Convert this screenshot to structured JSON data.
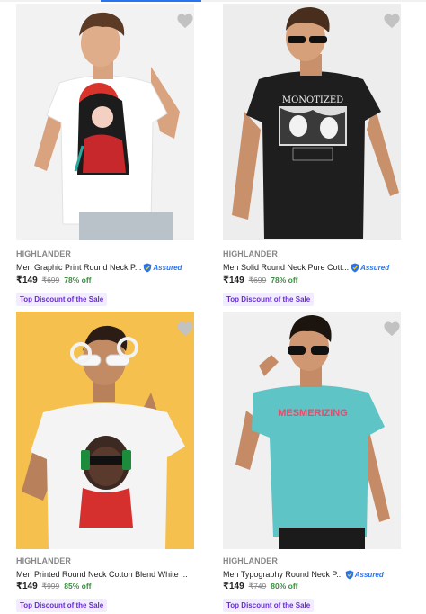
{
  "products": [
    {
      "brand": "HIGHLANDER",
      "title": "Men Graphic Print Round Neck P...",
      "assured": true,
      "assured_label": "Assured",
      "price": "₹149",
      "mrp": "₹699",
      "discount": "78% off",
      "badge": "Top Discount of the Sale",
      "tee_color": "#ffffff",
      "bg_color": "#f3f3f3",
      "print_text": ""
    },
    {
      "brand": "HIGHLANDER",
      "title": "Men Solid Round Neck Pure Cott...",
      "assured": true,
      "assured_label": "Assured",
      "price": "₹149",
      "mrp": "₹699",
      "discount": "78% off",
      "badge": "Top Discount of the Sale",
      "tee_color": "#1e1e1e",
      "bg_color": "#ededed",
      "print_text": "MONOTIZED"
    },
    {
      "brand": "HIGHLANDER",
      "title": "Men Printed Round Neck Cotton Blend White ...",
      "assured": false,
      "assured_label": "",
      "price": "₹149",
      "mrp": "₹999",
      "discount": "85% off",
      "badge": "Top Discount of the Sale",
      "tee_color": "#f4f4f4",
      "bg_color": "#f5c04d",
      "print_text": ""
    },
    {
      "brand": "HIGHLANDER",
      "title": "Men Typography Round Neck P...",
      "assured": true,
      "assured_label": "Assured",
      "price": "₹149",
      "mrp": "₹749",
      "discount": "80% off",
      "badge": "Top Discount of the Sale",
      "tee_color": "#5ec4c6",
      "bg_color": "#f0f0f0",
      "print_text": "MESMERIZING"
    }
  ],
  "colors": {
    "accent": "#2874f0",
    "discount_green": "#388e3c",
    "badge_purple": "#6a2bd6",
    "wishlist_grey": "#c2c2c2"
  }
}
